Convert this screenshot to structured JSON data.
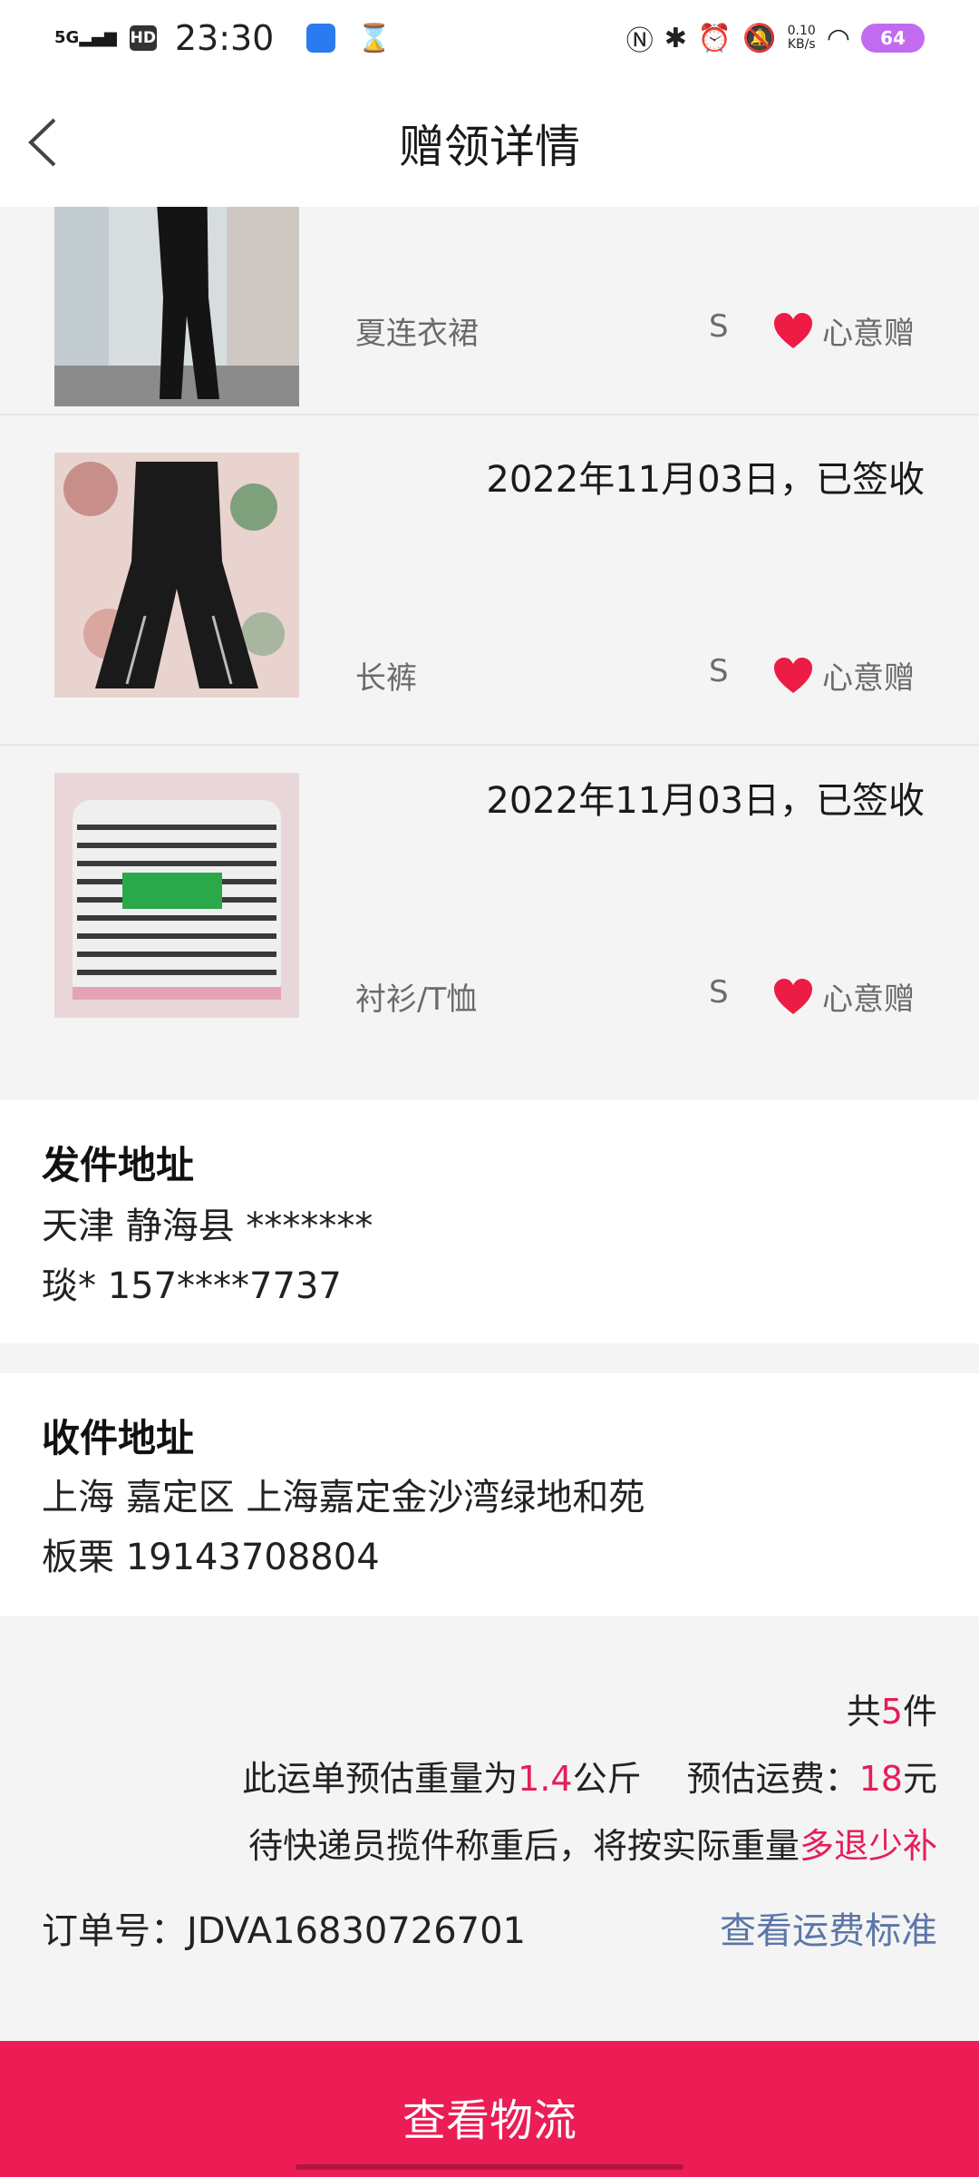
{
  "status_bar": {
    "network": "5G",
    "hd": "HD",
    "time": "23:30",
    "speed_value": "0.10",
    "speed_unit": "KB/s",
    "battery": "64"
  },
  "header": {
    "title": "赠领详情"
  },
  "items": [
    {
      "date": "",
      "category": "夏连衣裙",
      "size": "S",
      "tag": "心意赠"
    },
    {
      "date": "2022年11月03日，已签收",
      "category": "长裤",
      "size": "S",
      "tag": "心意赠"
    },
    {
      "date": "2022年11月03日，已签收",
      "category": "衬衫/T恤",
      "size": "S",
      "tag": "心意赠"
    }
  ],
  "sender": {
    "title": "发件地址",
    "address": "天津 静海县 *******",
    "contact": "琰* 157****7737"
  },
  "receiver": {
    "title": "收件地址",
    "address": "上海 嘉定区 上海嘉定金沙湾绿地和苑",
    "contact": "板栗 19143708804"
  },
  "summary": {
    "count_prefix": "共",
    "count": "5",
    "count_suffix": "件",
    "weight_prefix": "此运单预估重量为",
    "weight": "1.4",
    "weight_unit": "公斤",
    "fee_label": "预估运费：",
    "fee": "18",
    "fee_unit": "元",
    "note_prefix": "待快递员揽件称重后，将按实际重量",
    "note_highlight": "多退少补",
    "order_label": "订单号：",
    "order_no": "JDVA16830726701",
    "fee_standard_link": "查看运费标准"
  },
  "footer": {
    "button": "查看物流"
  },
  "colors": {
    "accent": "#ec1c55",
    "highlight": "#e51d58",
    "link": "#5b76a8"
  },
  "icons": [
    "back-icon",
    "heart-icon"
  ]
}
